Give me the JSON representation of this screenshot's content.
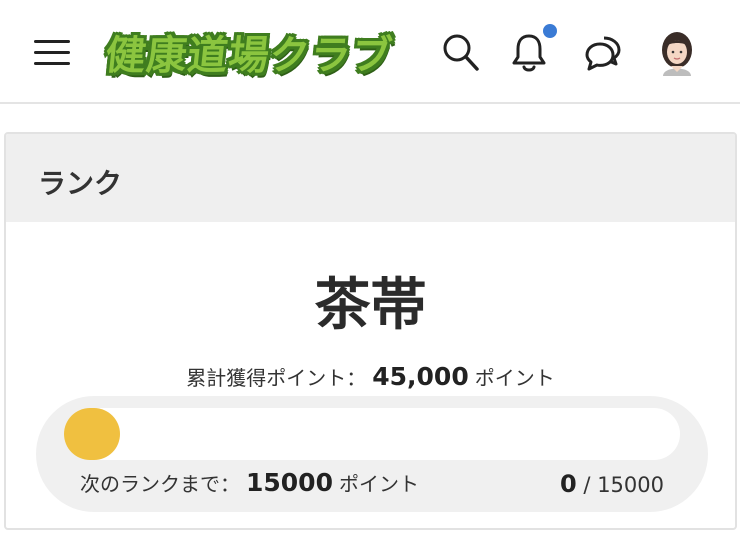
{
  "header": {
    "logo_text": "健康道場クラブ",
    "icons": {
      "menu": "hamburger-menu-icon",
      "search": "search-icon",
      "bell": "bell-icon",
      "chat": "chat-bubbles-icon",
      "avatar": "user-avatar"
    },
    "has_notification": true,
    "notify_color": "#3a7bd5"
  },
  "rank_card": {
    "title": "ランク",
    "rank_name": "茶帯",
    "total_label": "累計獲得ポイント：",
    "total_points": "45,000",
    "total_unit": "ポイント",
    "next_label": "次のランクまで：",
    "next_points": "15000",
    "next_unit": "ポイント",
    "progress_current": "0",
    "progress_sep": " / ",
    "progress_max": "15000",
    "progress_fraction": 0.0,
    "fill_color": "#f0c040"
  }
}
